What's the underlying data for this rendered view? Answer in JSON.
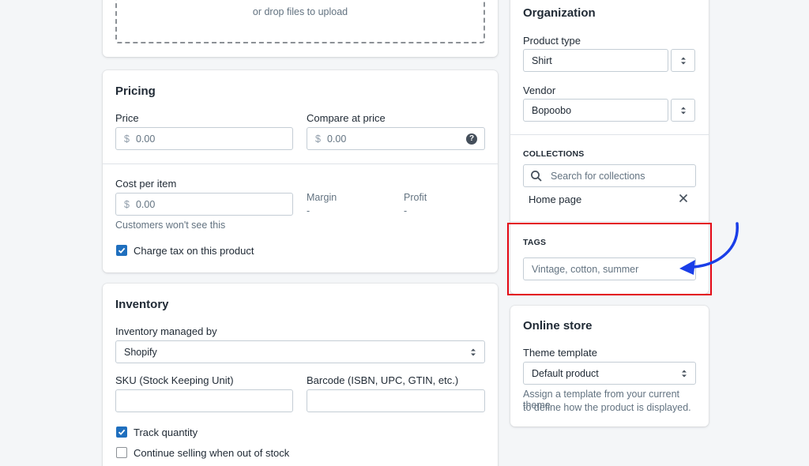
{
  "media": {
    "drop_text": "or drop files to upload"
  },
  "pricing": {
    "title": "Pricing",
    "price_label": "Price",
    "price_currency": "$",
    "price_value": "0.00",
    "compare_label": "Compare at price",
    "compare_currency": "$",
    "compare_value": "0.00",
    "cost_label": "Cost per item",
    "cost_currency": "$",
    "cost_value": "0.00",
    "cost_help": "Customers won't see this",
    "margin_label": "Margin",
    "margin_value": "-",
    "profit_label": "Profit",
    "profit_value": "-",
    "charge_tax_label": "Charge tax on this product",
    "charge_tax_checked": true
  },
  "inventory": {
    "title": "Inventory",
    "managed_label": "Inventory managed by",
    "managed_value": "Shopify",
    "sku_label": "SKU (Stock Keeping Unit)",
    "barcode_label": "Barcode (ISBN, UPC, GTIN, etc.)",
    "track_label": "Track quantity",
    "track_checked": true,
    "continue_label": "Continue selling when out of stock",
    "continue_checked": false
  },
  "organization": {
    "title": "Organization",
    "product_type_label": "Product type",
    "product_type_value": "Shirt",
    "vendor_label": "Vendor",
    "vendor_value": "Bopoobo",
    "collections_title": "COLLECTIONS",
    "collections_search_placeholder": "Search for collections",
    "collection_item": "Home page",
    "tags_title": "TAGS",
    "tags_placeholder": "Vintage, cotton, summer"
  },
  "online_store": {
    "title": "Online store",
    "theme_label": "Theme template",
    "theme_value": "Default product",
    "theme_help_line1": "Assign a template from your current theme",
    "theme_help_line2": "to define how the product is displayed."
  },
  "annotation": {
    "highlight_color": "#e30613",
    "arrow_color": "#1a3ee8"
  }
}
